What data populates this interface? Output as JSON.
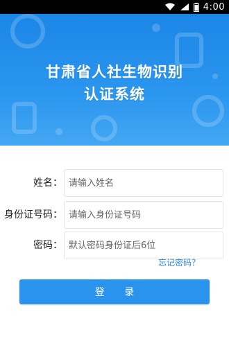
{
  "status_bar": {
    "time": "4:00"
  },
  "header": {
    "title_line1": "甘肃省人社生物识别",
    "title_line2": "认证系统",
    "background_color": "#2b96ef"
  },
  "form": {
    "name": {
      "label": "姓名：",
      "placeholder": "请输入姓名"
    },
    "id_number": {
      "label": "身份证号码：",
      "placeholder": "请输入身份证号码"
    },
    "password": {
      "label": "密码：",
      "placeholder": "默认密码身份证后6位"
    },
    "forgot_password": "忘记密码？",
    "login_button": "登 录"
  },
  "colors": {
    "accent": "#2a93ee",
    "link": "#2a86d8"
  }
}
